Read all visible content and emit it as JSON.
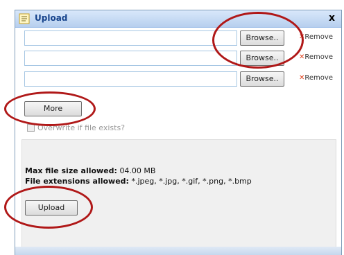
{
  "dialog": {
    "title": "Upload",
    "close_label": "x"
  },
  "file_rows": [
    {
      "browse_label": "Browse..",
      "remove_label": "Remove",
      "value": ""
    },
    {
      "browse_label": "Browse..",
      "remove_label": "Remove",
      "value": ""
    },
    {
      "browse_label": "Browse..",
      "remove_label": "Remove",
      "value": ""
    }
  ],
  "more_button": {
    "label": "More"
  },
  "overwrite": {
    "label": "Overwrite if file exists?",
    "checked": false
  },
  "info": {
    "max_size_label": "Max file size allowed:",
    "max_size_value": "04.00 MB",
    "extensions_label": "File extensions allowed:",
    "extensions_value": "*.jpeg, *.jpg, *.gif, *.png, *.bmp"
  },
  "upload_button": {
    "label": "Upload"
  },
  "colors": {
    "annotation_circle": "#b01818",
    "remove_x": "#e0401a",
    "title_text": "#15428b"
  },
  "icons": {
    "title": "upload-dialog-icon",
    "remove": "x-mark-icon"
  }
}
